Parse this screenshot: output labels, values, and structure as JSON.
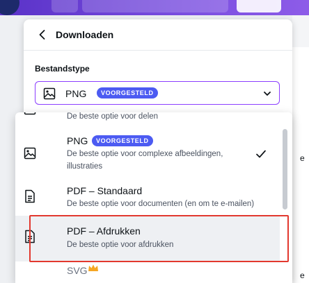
{
  "panel": {
    "title": "Downloaden",
    "file_type_label": "Bestandstype"
  },
  "select": {
    "value": "PNG",
    "badge": "VOORGESTELD"
  },
  "options": [
    {
      "title": "",
      "description": "De beste optie voor delen",
      "icon": "image-icon"
    },
    {
      "title": "PNG",
      "badge": "VOORGESTELD",
      "description_line1": "De beste optie voor complexe afbeeldingen,",
      "description_line2": "illustraties",
      "selected": true,
      "icon": "image-icon"
    },
    {
      "title": "PDF – Standaard",
      "description": "De beste optie voor documenten (en om te e-mailen)",
      "icon": "document-icon"
    },
    {
      "title": "PDF – Afdrukken",
      "description": "De beste optie voor afdrukken",
      "icon": "document-icon"
    },
    {
      "title": "SVG",
      "icon": "crown-icon"
    }
  ],
  "side_letters": [
    "e",
    "e"
  ],
  "colors": {
    "accent": "#8b3dff",
    "badge": "#4c5bf2",
    "highlight": "#e2382e"
  }
}
